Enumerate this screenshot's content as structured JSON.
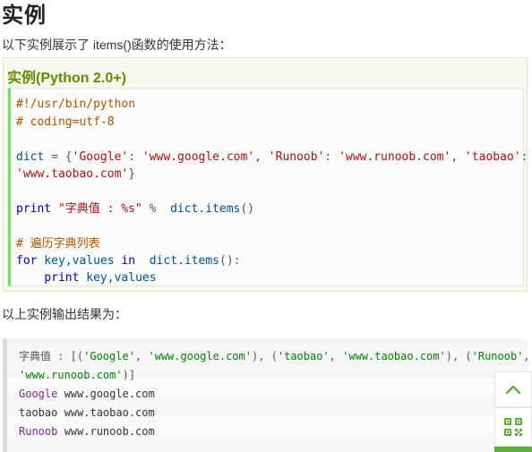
{
  "page": {
    "heading": "实例",
    "intro": "以下实例展示了 items()函数的使用方法：",
    "output_label": "以上实例输出结果为："
  },
  "example": {
    "title": "实例(Python 2.0+)",
    "code": {
      "shebang": "#!/usr/bin/python",
      "coding": "# coding=utf-8",
      "dict_name": "dict",
      "eq_open": " = {",
      "k1": "'Google'",
      "v1": "'www.google.com'",
      "k2": "'Runoob'",
      "v2": "'www.runoob.com'",
      "k3": "'taobao'",
      "v3": "'www.taobao.com'",
      "colon": ": ",
      "comma": ", ",
      "colon_end": ":",
      "close_brace": "}",
      "print_kw": "print",
      "print_str": "\"字典值 : %s\"",
      "print_mod": " %  ",
      "call_items": "dict.items",
      "call_parens": "()",
      "comment_loop": "# 遍历字典列表",
      "for_kw": "for",
      "for_vars": " key,values ",
      "in_kw": "in",
      "for_tail": "  ",
      "call_parens_colon": "():",
      "indent": "    ",
      "print_vars": " key,values"
    }
  },
  "output": {
    "line1_prefix": "字典值 : [(",
    "line1_rest": "), (",
    "o1": "'Google'",
    "o2": "'www.google.com'",
    "o3": "'taobao'",
    "o4": "'www.taobao.com'",
    "o5": "'Runoob'",
    "o6": "'www.runoob.com'",
    "sep": ", ",
    "line2_end": ")]",
    "rows": [
      {
        "name": "Google",
        "url": " www.google.com"
      },
      {
        "name": "taobao",
        "url": " www.taobao.com"
      },
      {
        "name": "Runoob",
        "url": " www.runoob.com"
      }
    ]
  },
  "widgets": {
    "top_icon": "chevron-up-icon",
    "qr_icon": "qr-code-icon",
    "accent": "#5fae3b"
  }
}
